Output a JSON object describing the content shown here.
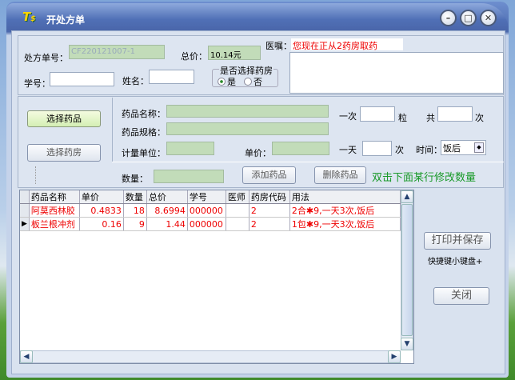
{
  "window": {
    "title": "开处方单",
    "logo": "T$"
  },
  "header": {
    "rx_no_label": "处方单号：",
    "rx_no_value": "CF220121007-1",
    "total_label": "总价：",
    "total_value": "10.14元",
    "advice_label": "医嘱：",
    "advice_notice": "您现在正从2药房取药",
    "student_label": "学号：",
    "name_label": "姓名：",
    "pharmacy_group": "是否选择药房",
    "yes": "是",
    "no": "否"
  },
  "drug": {
    "select_drug": "选择药品",
    "select_pharmacy": "选择药房",
    "name_label": "药品名称：",
    "spec_label": "药品规格：",
    "unit_label": "计量单位：",
    "price_label": "单价：",
    "once_label": "一次",
    "grain": "粒",
    "total_label": "共",
    "times": "次",
    "day_label": "一天",
    "times2": "次",
    "time_label": "时间：",
    "time_value": "饭后",
    "qty_label": "数量：",
    "add": "添加药品",
    "delete": "删除药品",
    "hint": "双击下面某行修改数量"
  },
  "table": {
    "columns": [
      "药品名称",
      "单价",
      "数量",
      "总价",
      "学号",
      "医师",
      "药房代码",
      "用法"
    ],
    "rows": [
      [
        "阿莫西林胶",
        "0.4833",
        "18",
        "8.6994",
        "000000",
        "",
        "2",
        "2合✱9,一天3次,饭后"
      ],
      [
        "板兰根冲剂",
        "0.16",
        "9",
        "1.44",
        "000000",
        "",
        "2",
        "1包✱9,一天3次,饭后"
      ]
    ],
    "current_row": 1
  },
  "side": {
    "print_save": "打印并保存",
    "shortcut": "快捷键小键盘+",
    "close": "关闭"
  }
}
